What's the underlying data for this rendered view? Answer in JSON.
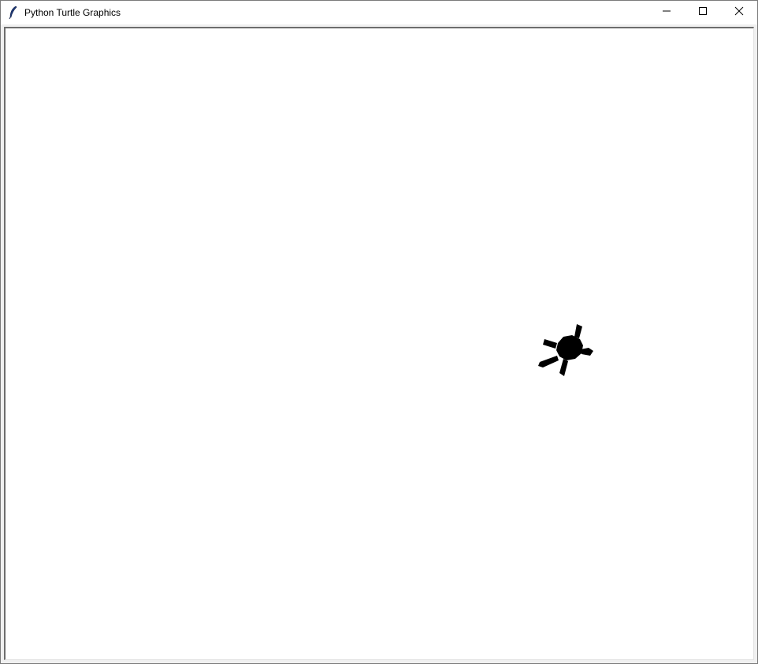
{
  "window": {
    "title": "Python Turtle Graphics",
    "app_icon": "feather-icon",
    "controls": {
      "minimize_icon": "minimize-icon",
      "maximize_icon": "maximize-icon",
      "close_icon": "close-icon"
    }
  },
  "canvas": {
    "background": "#ffffff",
    "turtle": {
      "shape": "turtle",
      "color": "#000000"
    }
  }
}
